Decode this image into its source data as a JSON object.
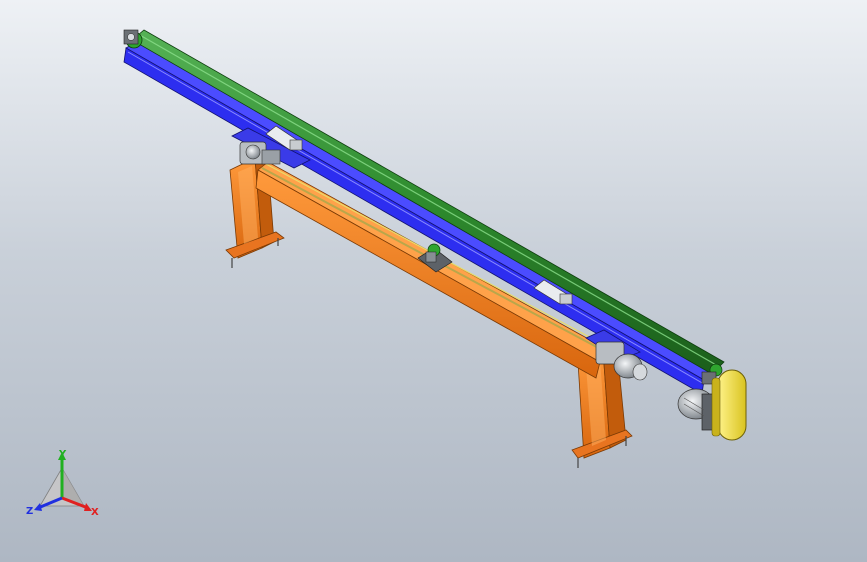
{
  "viewport": {
    "background_top": "#eef1f5",
    "background_bottom": "#aeb7c3"
  },
  "model": {
    "frame_color": "#f47f1e",
    "track_color": "#2d2ef0",
    "roller_color": "#2e8b2e",
    "guard_color": "#f2e23b",
    "motor_color": "#c7ccd1"
  },
  "triad": {
    "x_label": "X",
    "y_label": "Y",
    "z_label": "Z",
    "x_color": "#e02020",
    "y_color": "#20b020",
    "z_color": "#2030e0"
  }
}
